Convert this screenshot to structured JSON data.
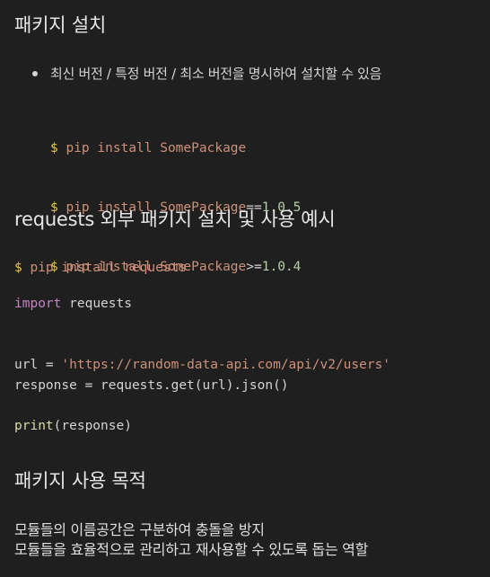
{
  "section1": {
    "heading": "패키지 설치",
    "bullet": "최신 버전 / 특정 버전 / 최소 버전을 명시하여 설치할 수 있음",
    "commands": [
      {
        "prompt": "$",
        "cmd": "pip install SomePackage",
        "op": "",
        "version": ""
      },
      {
        "prompt": "$",
        "cmd": "pip install SomePackage",
        "op": "==",
        "version": "1.0.5"
      },
      {
        "prompt": "$",
        "cmd": "pip install SomePackage",
        "op": ">=",
        "version": "1.0.4"
      }
    ]
  },
  "section2": {
    "heading": "requests 외부 패키지 설치 및 사용 예시",
    "install": {
      "prompt": "$",
      "cmd": "pip install requests"
    },
    "import_kw": "import",
    "import_mod": "requests",
    "url_lhs": "url = ",
    "url_str": "'https://random-data-api.com/api/v2/users'",
    "response_line": "response = requests.get(url).json()",
    "print_fn": "print",
    "print_args": "(response)"
  },
  "section3": {
    "heading": "패키지 사용 목적",
    "lines": [
      "모듈들의 이름공간은 구분하여 충돌을 방지",
      "모듈들을 효율적으로 관리하고 재사용할 수 있도록 돕는 역할"
    ]
  },
  "colors": {
    "background": "#1f1f1f",
    "text": "#d4d4d4",
    "shell": "#e9c062",
    "string": "#ce9178",
    "number": "#b5cea8",
    "keyword": "#c586c0"
  }
}
